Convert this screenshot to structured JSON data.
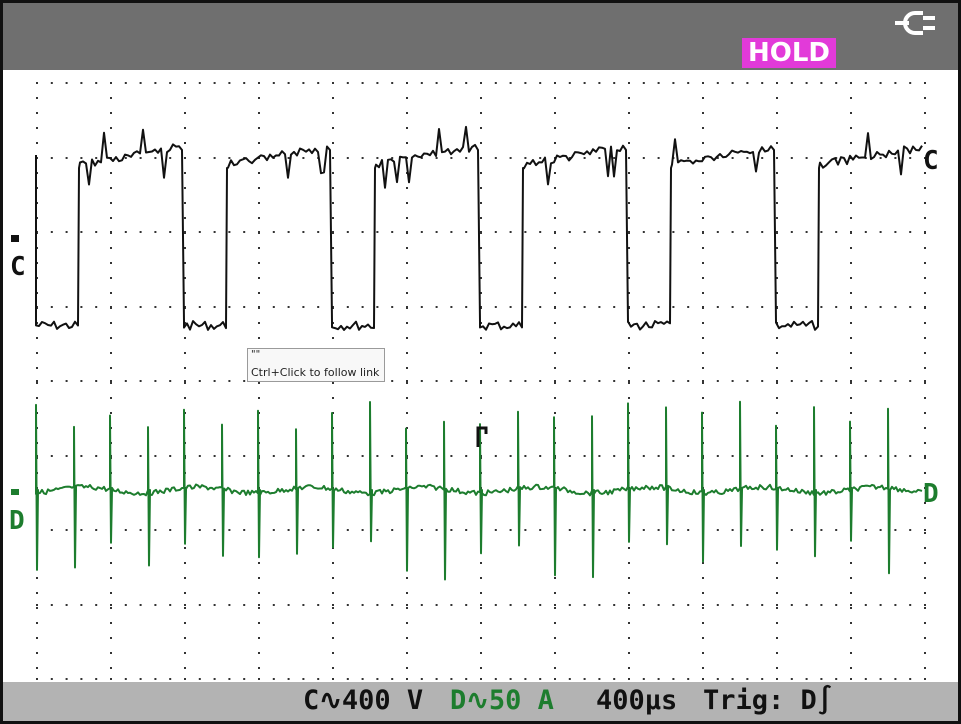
{
  "hold_label": "HOLD",
  "tooltip": {
    "line1": "\"\"",
    "line2": "Ctrl+Click to follow link"
  },
  "channels": {
    "c": {
      "label": "C",
      "color": "#111111",
      "scale": "C∿400 V"
    },
    "d": {
      "label": "D",
      "color": "#1d7d2e",
      "scale": "D∿50 A"
    }
  },
  "timebase": "400µs",
  "trigger": "Trig: D∫",
  "icons": {
    "power": "ac-plug-icon",
    "trigger_marker": "trigger-marker-icon"
  },
  "colors": {
    "top_bar": "#6f6f6f",
    "status_bar": "#b3b3b3",
    "hold_bg": "#e23ad9",
    "grid": "#333333"
  }
}
